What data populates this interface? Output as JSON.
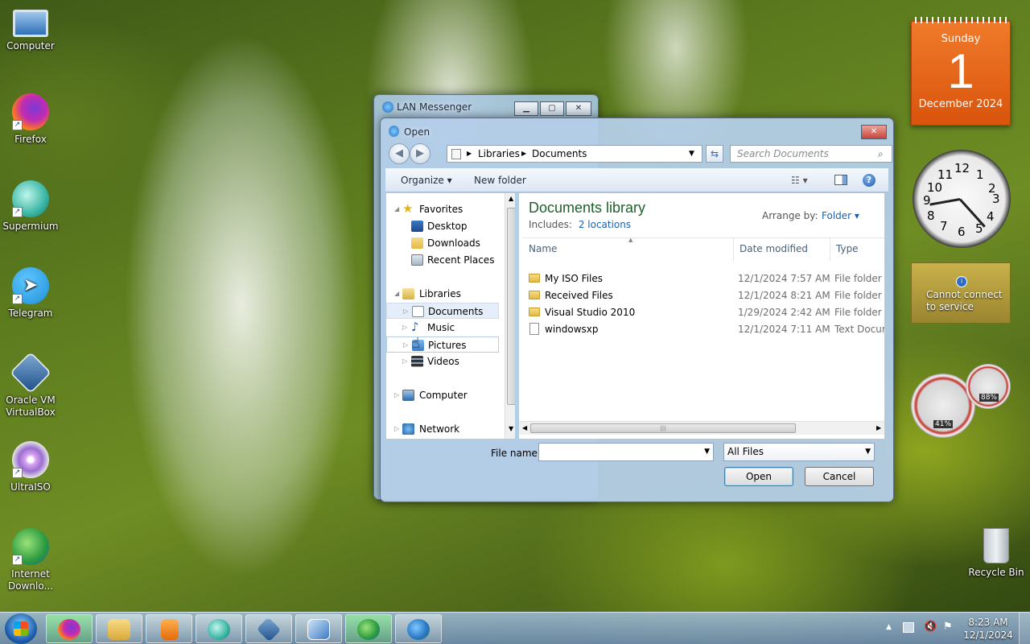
{
  "desktop": {
    "icons": [
      {
        "label": "Computer",
        "icon": "computer-icon"
      },
      {
        "label": "Firefox",
        "icon": "firefox-icon"
      },
      {
        "label": "Supermium",
        "icon": "supermium-icon"
      },
      {
        "label": "Telegram",
        "icon": "telegram-icon"
      },
      {
        "label": "Oracle VM VirtualBox",
        "icon": "virtualbox-icon"
      },
      {
        "label": "UltraISO",
        "icon": "ultraiso-icon"
      },
      {
        "label": "Internet Downlo...",
        "icon": "internet-download-manager-icon"
      }
    ],
    "recycle_bin": "Recycle Bin"
  },
  "gadgets": {
    "calendar": {
      "day_name": "Sunday",
      "day": "1",
      "month_year": "December 2024"
    },
    "clock": {
      "numerals": [
        "12",
        "1",
        "2",
        "3",
        "4",
        "5",
        "6",
        "7",
        "8",
        "9",
        "10",
        "11"
      ]
    },
    "weather": {
      "message": "Cannot connect to service"
    },
    "cpu_meter": {
      "cpu": "41%",
      "memory": "88%"
    }
  },
  "lan_messenger": {
    "title": "LAN Messenger"
  },
  "dialog": {
    "title": "Open",
    "address": [
      "Libraries",
      "Documents"
    ],
    "search_placeholder": "Search Documents",
    "toolbar": {
      "organize": "Organize",
      "new_folder": "New folder"
    },
    "tree": {
      "favorites": "Favorites",
      "desktop": "Desktop",
      "downloads": "Downloads",
      "recent": "Recent Places",
      "libraries": "Libraries",
      "documents": "Documents",
      "music": "Music",
      "pictures": "Pictures",
      "videos": "Videos",
      "computer": "Computer",
      "network": "Network"
    },
    "library": {
      "title": "Documents library",
      "includes_label": "Includes:",
      "includes_link": "2 locations",
      "arrange_label": "Arrange by:",
      "arrange_value": "Folder"
    },
    "columns": {
      "name": "Name",
      "date": "Date modified",
      "type": "Type"
    },
    "files": [
      {
        "name": "My ISO Files",
        "date": "12/1/2024 7:57 AM",
        "type": "File folder",
        "kind": "folder"
      },
      {
        "name": "Received Files",
        "date": "12/1/2024 8:21 AM",
        "type": "File folder",
        "kind": "folder"
      },
      {
        "name": "Visual Studio 2010",
        "date": "1/29/2024 2:42 AM",
        "type": "File folder",
        "kind": "folder"
      },
      {
        "name": "windowsxp",
        "date": "12/1/2024 7:11 AM",
        "type": "Text Docume",
        "kind": "text"
      }
    ],
    "file_name_label": "File name:",
    "file_name_value": "",
    "filter": "All Files",
    "open_button": "Open",
    "cancel_button": "Cancel"
  },
  "taskbar": {
    "apps": [
      "firefox-icon",
      "explorer-icon",
      "media-player-icon",
      "supermium-icon",
      "virtualbox-icon",
      "windows-8-1-icon",
      "internet-download-manager-icon",
      "lan-messenger-icon"
    ],
    "start_icon": "windows-start-icon",
    "clock_time": "8:23 AM",
    "clock_date": "12/1/2024"
  }
}
